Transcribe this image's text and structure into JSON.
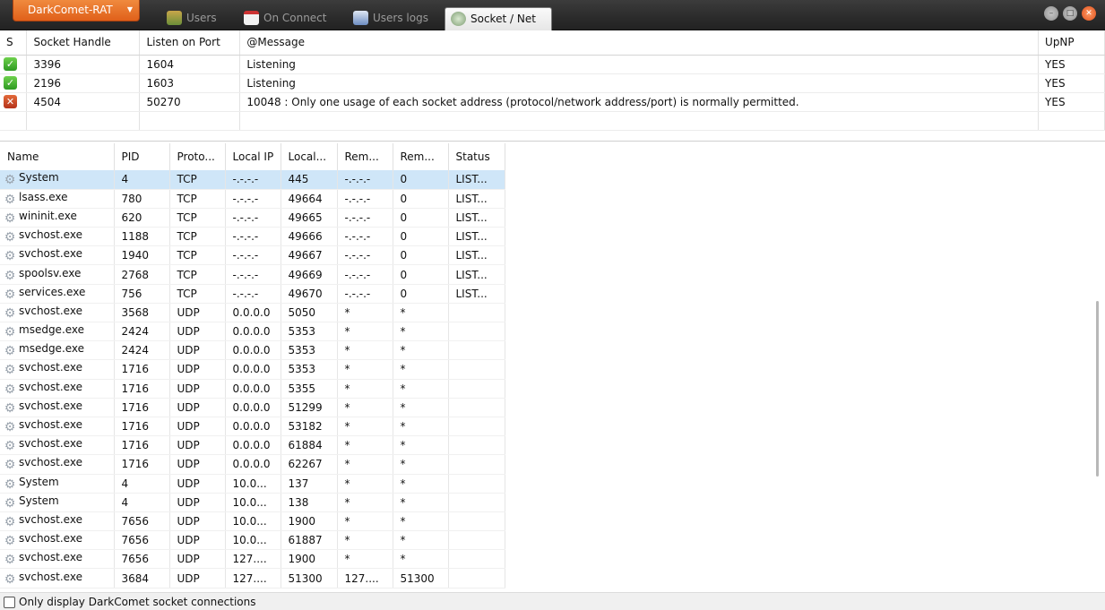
{
  "app": {
    "menu_label": "DarkComet-RAT",
    "tabs": [
      {
        "label": "Users",
        "icon": "users-icon",
        "active": false
      },
      {
        "label": "On Connect",
        "icon": "calendar-icon",
        "active": false
      },
      {
        "label": "Users logs",
        "icon": "logs-icon",
        "active": false
      },
      {
        "label": "Socket / Net",
        "icon": "network-icon",
        "active": true
      }
    ]
  },
  "socket_table": {
    "columns": [
      "S",
      "Socket Handle",
      "Listen on Port",
      "@Message",
      "UpNP"
    ],
    "rows": [
      {
        "status": "ok",
        "status_glyph": "✓",
        "handle": "3396",
        "port": "1604",
        "message": "Listening",
        "upnp": "YES"
      },
      {
        "status": "ok",
        "status_glyph": "✓",
        "handle": "2196",
        "port": "1603",
        "message": "Listening",
        "upnp": "YES"
      },
      {
        "status": "error",
        "status_glyph": "✕",
        "handle": "4504",
        "port": "50270",
        "message": "10048 : Only one usage of each socket address (protocol/network address/port) is normally permitted.",
        "upnp": "YES"
      }
    ]
  },
  "connections": {
    "columns": [
      "Name",
      "PID",
      "Proto...",
      "Local IP",
      "Local...",
      "Rem...",
      "Rem...",
      "Status"
    ],
    "rows": [
      [
        "System",
        "4",
        "TCP",
        "-.-.-.-",
        "445",
        "-.-.-.-",
        "0",
        "LIST..."
      ],
      [
        "lsass.exe",
        "780",
        "TCP",
        "-.-.-.-",
        "49664",
        "-.-.-.-",
        "0",
        "LIST..."
      ],
      [
        "wininit.exe",
        "620",
        "TCP",
        "-.-.-.-",
        "49665",
        "-.-.-.-",
        "0",
        "LIST..."
      ],
      [
        "svchost.exe",
        "1188",
        "TCP",
        "-.-.-.-",
        "49666",
        "-.-.-.-",
        "0",
        "LIST..."
      ],
      [
        "svchost.exe",
        "1940",
        "TCP",
        "-.-.-.-",
        "49667",
        "-.-.-.-",
        "0",
        "LIST..."
      ],
      [
        "spoolsv.exe",
        "2768",
        "TCP",
        "-.-.-.-",
        "49669",
        "-.-.-.-",
        "0",
        "LIST..."
      ],
      [
        "services.exe",
        "756",
        "TCP",
        "-.-.-.-",
        "49670",
        "-.-.-.-",
        "0",
        "LIST..."
      ],
      [
        "svchost.exe",
        "3568",
        "UDP",
        "0.0.0.0",
        "5050",
        "*",
        "*",
        ""
      ],
      [
        "msedge.exe",
        "2424",
        "UDP",
        "0.0.0.0",
        "5353",
        "*",
        "*",
        ""
      ],
      [
        "msedge.exe",
        "2424",
        "UDP",
        "0.0.0.0",
        "5353",
        "*",
        "*",
        ""
      ],
      [
        "svchost.exe",
        "1716",
        "UDP",
        "0.0.0.0",
        "5353",
        "*",
        "*",
        ""
      ],
      [
        "svchost.exe",
        "1716",
        "UDP",
        "0.0.0.0",
        "5355",
        "*",
        "*",
        ""
      ],
      [
        "svchost.exe",
        "1716",
        "UDP",
        "0.0.0.0",
        "51299",
        "*",
        "*",
        ""
      ],
      [
        "svchost.exe",
        "1716",
        "UDP",
        "0.0.0.0",
        "53182",
        "*",
        "*",
        ""
      ],
      [
        "svchost.exe",
        "1716",
        "UDP",
        "0.0.0.0",
        "61884",
        "*",
        "*",
        ""
      ],
      [
        "svchost.exe",
        "1716",
        "UDP",
        "0.0.0.0",
        "62267",
        "*",
        "*",
        ""
      ],
      [
        "System",
        "4",
        "UDP",
        "10.0...",
        "137",
        "*",
        "*",
        ""
      ],
      [
        "System",
        "4",
        "UDP",
        "10.0...",
        "138",
        "*",
        "*",
        ""
      ],
      [
        "svchost.exe",
        "7656",
        "UDP",
        "10.0...",
        "1900",
        "*",
        "*",
        ""
      ],
      [
        "svchost.exe",
        "7656",
        "UDP",
        "10.0...",
        "61887",
        "*",
        "*",
        ""
      ],
      [
        "svchost.exe",
        "7656",
        "UDP",
        "127....",
        "1900",
        "*",
        "*",
        ""
      ],
      [
        "svchost.exe",
        "3684",
        "UDP",
        "127....",
        "51300",
        "127....",
        "51300",
        ""
      ]
    ],
    "selected_row": 0
  },
  "footer": {
    "checkbox_label": "Only display DarkComet socket connections",
    "checked": false
  },
  "colors": {
    "accent": "#e8702a",
    "selection": "#cfe6f8",
    "ok": "#3aa82a",
    "error": "#c2401f"
  }
}
